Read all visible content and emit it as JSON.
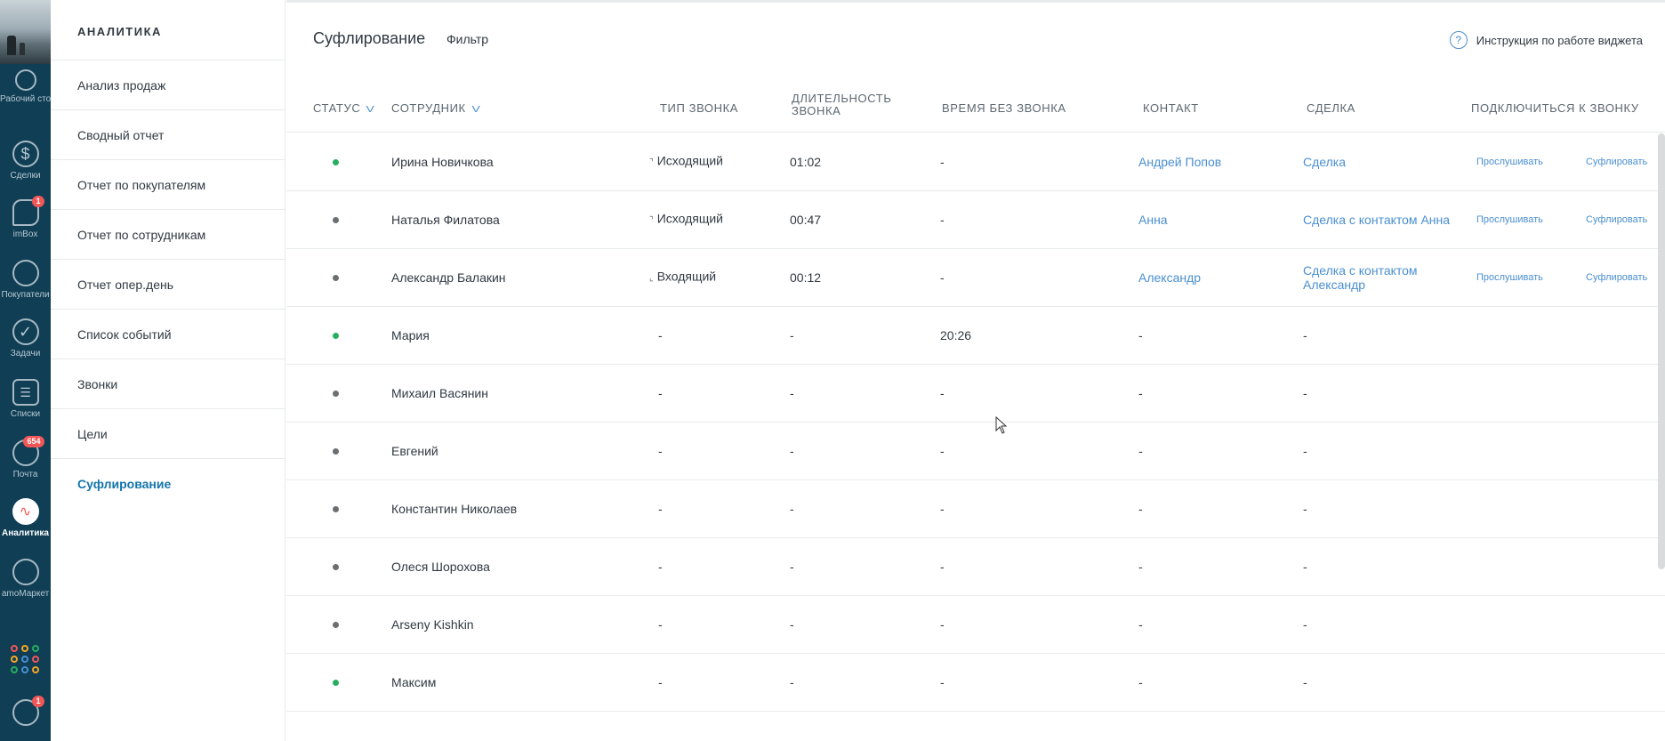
{
  "rail": {
    "items": [
      {
        "label": "Рабочий стол",
        "icon": "desktop-icon"
      },
      {
        "label": "Сделки",
        "icon": "dollar-icon"
      },
      {
        "label": "imBox",
        "icon": "chat-icon",
        "badge": "1"
      },
      {
        "label": "Покупатели",
        "icon": "customers-icon"
      },
      {
        "label": "Задачи",
        "icon": "check-icon"
      },
      {
        "label": "Списки",
        "icon": "lists-icon"
      },
      {
        "label": "Почта",
        "icon": "mail-icon",
        "badge": "654"
      },
      {
        "label": "Аналитика",
        "icon": "analytics-icon"
      },
      {
        "label": "amoМаркет",
        "icon": "market-icon"
      }
    ],
    "notifications_badge": "1"
  },
  "menu": {
    "title": "АНАЛИТИКА",
    "items": [
      "Анализ продаж",
      "Сводный отчет",
      "Отчет по покупателям",
      "Отчет по сотрудникам",
      "Отчет опер.день",
      "Список событий",
      "Звонки",
      "Цели",
      "Суфлирование"
    ]
  },
  "header": {
    "title": "Суфлирование",
    "filter": "Фильтр",
    "help": "Инструкция по работе виджета"
  },
  "columns": {
    "status": "СТАТУС",
    "employee": "СОТРУДНИК",
    "call_type": "ТИП ЗВОНКА",
    "duration": "ДЛИТЕЛЬНОСТЬ ЗВОНКА",
    "idle": "ВРЕМЯ БЕЗ ЗВОНКА",
    "contact": "КОНТАКТ",
    "deal": "СДЕЛКА",
    "connect": "ПОДКЛЮЧИТЬСЯ К ЗВОНКУ"
  },
  "colors": {
    "online": "#27ae60",
    "offline": "#6b6f72",
    "link": "#4a8fd0"
  },
  "rows": [
    {
      "status": "online",
      "name": "Ирина Новичкова",
      "type": "Исходящий",
      "dir": "out",
      "duration": "01:02",
      "idle": "-",
      "contact": "Андрей Попов",
      "deal": "Сделка",
      "listen": "Прослушивать",
      "prompt": "Суфлировать"
    },
    {
      "status": "offline",
      "name": "Наталья Филатова",
      "type": "Исходящий",
      "dir": "out",
      "duration": "00:47",
      "idle": "-",
      "contact": "Анна",
      "deal": "Сделка с контактом Анна",
      "listen": "Прослушивать",
      "prompt": "Суфлировать"
    },
    {
      "status": "offline",
      "name": "Александр Балакин",
      "type": "Входящий",
      "dir": "in",
      "duration": "00:12",
      "idle": "-",
      "contact": "Александр",
      "deal": "Сделка с контактом Александр",
      "listen": "Прослушивать",
      "prompt": "Суфлировать"
    },
    {
      "status": "online",
      "name": "Мария",
      "type": "-",
      "duration": "-",
      "idle": "20:26",
      "contact": "-",
      "deal": "-"
    },
    {
      "status": "offline",
      "name": "Михаил Васянин",
      "type": "-",
      "duration": "-",
      "idle": "-",
      "contact": "-",
      "deal": "-"
    },
    {
      "status": "offline",
      "name": "Евгений",
      "type": "-",
      "duration": "-",
      "idle": "-",
      "contact": "-",
      "deal": "-"
    },
    {
      "status": "offline",
      "name": "Константин Николаев",
      "type": "-",
      "duration": "-",
      "idle": "-",
      "contact": "-",
      "deal": "-"
    },
    {
      "status": "offline",
      "name": "Олеся Шорохова",
      "type": "-",
      "duration": "-",
      "idle": "-",
      "contact": "-",
      "deal": "-"
    },
    {
      "status": "offline",
      "name": "Arseny Kishkin",
      "type": "-",
      "duration": "-",
      "idle": "-",
      "contact": "-",
      "deal": "-"
    },
    {
      "status": "online",
      "name": "Максим",
      "type": "-",
      "duration": "-",
      "idle": "-",
      "contact": "-",
      "deal": "-"
    }
  ]
}
